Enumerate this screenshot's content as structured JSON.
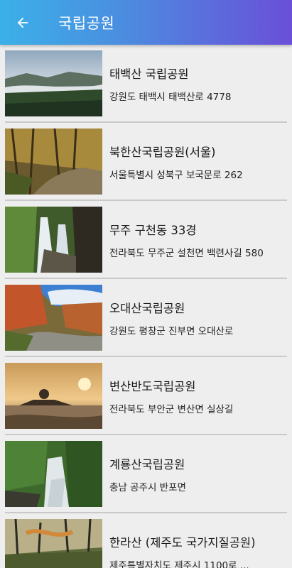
{
  "header": {
    "title": "국립공원",
    "back_icon": "arrow-left-icon"
  },
  "items": [
    {
      "name": "태백산 국립공원",
      "address": "강원도 태백시 태백산로 4778"
    },
    {
      "name": "북한산국립공원(서울)",
      "address": "서울특별시 성북구 보국문로 262"
    },
    {
      "name": "무주 구천동 33경",
      "address": "전라북도 무주군 설천면 백련사길 580"
    },
    {
      "name": "오대산국립공원",
      "address": "강원도 평창군 진부면 오대산로"
    },
    {
      "name": "변산반도국립공원",
      "address": "전라북도 부안군 변산면 실상길"
    },
    {
      "name": "계룡산국립공원",
      "address": "충남 공주시 반포면"
    },
    {
      "name": "한라산 (제주도 국가지질공원)",
      "address": "제주특별자치도 제주시 1100로 ..."
    }
  ]
}
